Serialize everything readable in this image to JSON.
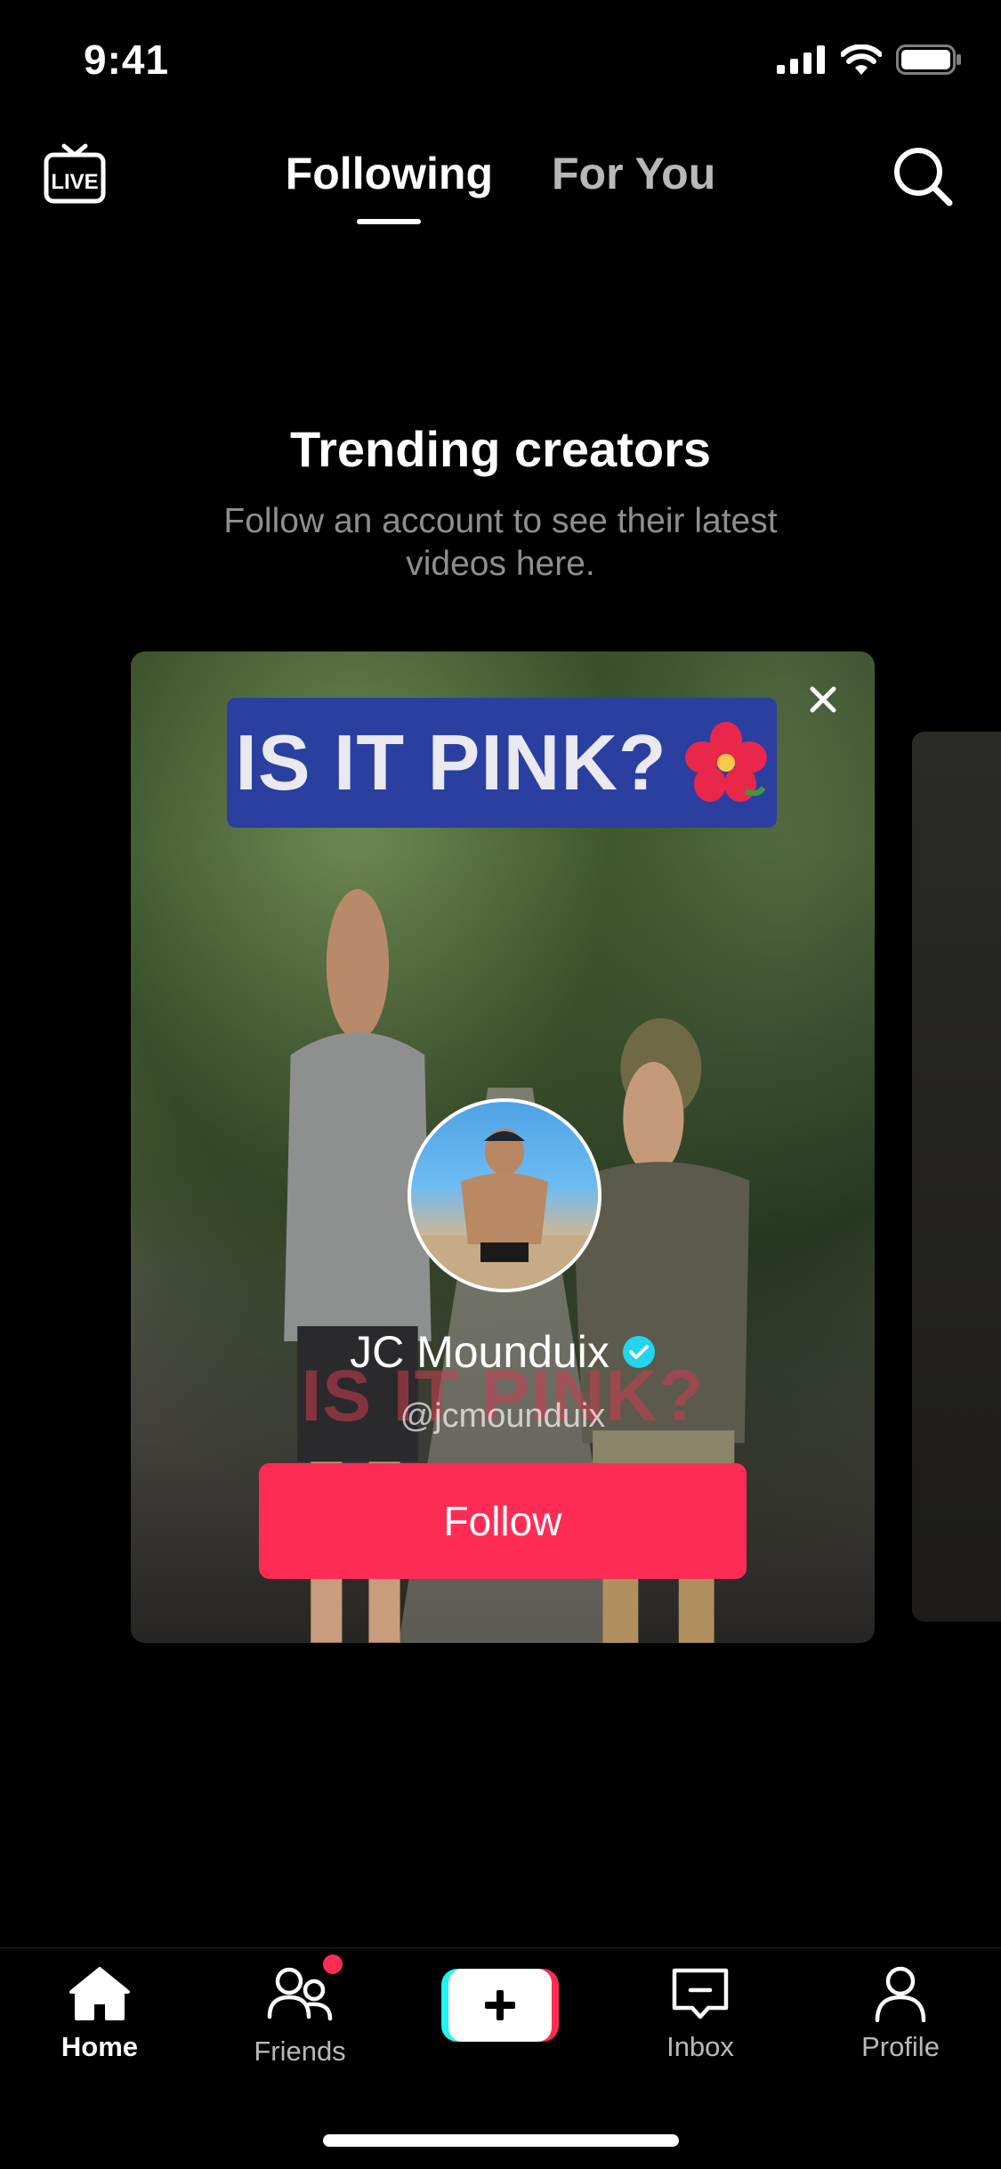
{
  "status_bar": {
    "time": "9:41"
  },
  "top_nav": {
    "tabs": [
      {
        "label": "Following",
        "active": true
      },
      {
        "label": "For You",
        "active": false
      }
    ],
    "live_label": "LIVE"
  },
  "section": {
    "title": "Trending creators",
    "subtitle": "Follow an account to see their latest videos here."
  },
  "creator_card": {
    "video_banner_text": "IS IT PINK?",
    "video_overlay_caption": "IS IT PINK?",
    "name": "JC Mounduix",
    "verified": true,
    "handle": "@jcmounduix",
    "follow_label": "Follow"
  },
  "bottom_nav": {
    "items": [
      {
        "label": "Home",
        "icon": "home-icon",
        "active": true
      },
      {
        "label": "Friends",
        "icon": "friends-icon",
        "active": false,
        "has_notification_dot": true
      },
      {
        "label": "",
        "icon": "create-plus-icon",
        "active": false
      },
      {
        "label": "Inbox",
        "icon": "inbox-icon",
        "active": false
      },
      {
        "label": "Profile",
        "icon": "profile-icon",
        "active": false
      }
    ]
  },
  "colors": {
    "accent": "#fe2c55",
    "background": "#000000",
    "verified": "#20d5ec"
  }
}
